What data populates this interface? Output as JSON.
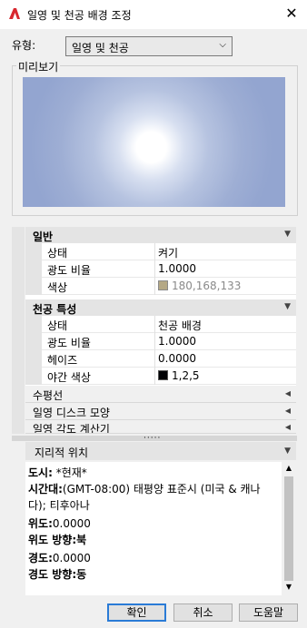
{
  "window": {
    "title": "일영 및 천공 배경 조정",
    "close_glyph": "✕"
  },
  "type_field": {
    "label": "유형:",
    "value": "일영 및 천공"
  },
  "preview": {
    "label": "미리보기"
  },
  "properties": {
    "general": {
      "header": "일반",
      "rows": [
        {
          "name": "상태",
          "value": "켜기"
        },
        {
          "name": "광도 비율",
          "value": "1.0000"
        },
        {
          "name": "색상",
          "value": "180,168,133",
          "swatch": "#b4a885"
        }
      ]
    },
    "sky": {
      "header": "천공 특성",
      "rows": [
        {
          "name": "상태",
          "value": "천공 배경"
        },
        {
          "name": "광도 비율",
          "value": "1.0000"
        },
        {
          "name": "헤이즈",
          "value": "0.0000"
        },
        {
          "name": "야간 색상",
          "value": "1,2,5",
          "swatch": "#010205"
        }
      ]
    },
    "collapsed": [
      {
        "label": "수평선"
      },
      {
        "label": "일영 디스크 모양"
      },
      {
        "label": "일영 각도 계산기"
      }
    ]
  },
  "geo": {
    "header": "지리적 위치",
    "lines": [
      {
        "key": "도시:",
        "value": " *현재*"
      },
      {
        "key": "시간대:",
        "value": "(GMT-08:00) 태평양 표준시 (미국 & 캐나"
      },
      {
        "key": "",
        "value": "다); 티후아나"
      },
      {
        "key": "위도:",
        "value": "0.0000"
      },
      {
        "key": "위도 방향:",
        "value": "북"
      },
      {
        "key": "경도:",
        "value": "0.0000"
      },
      {
        "key": "경도 방향:",
        "value": "동"
      }
    ]
  },
  "buttons": {
    "ok": "확인",
    "cancel": "취소",
    "help": "도움말"
  }
}
